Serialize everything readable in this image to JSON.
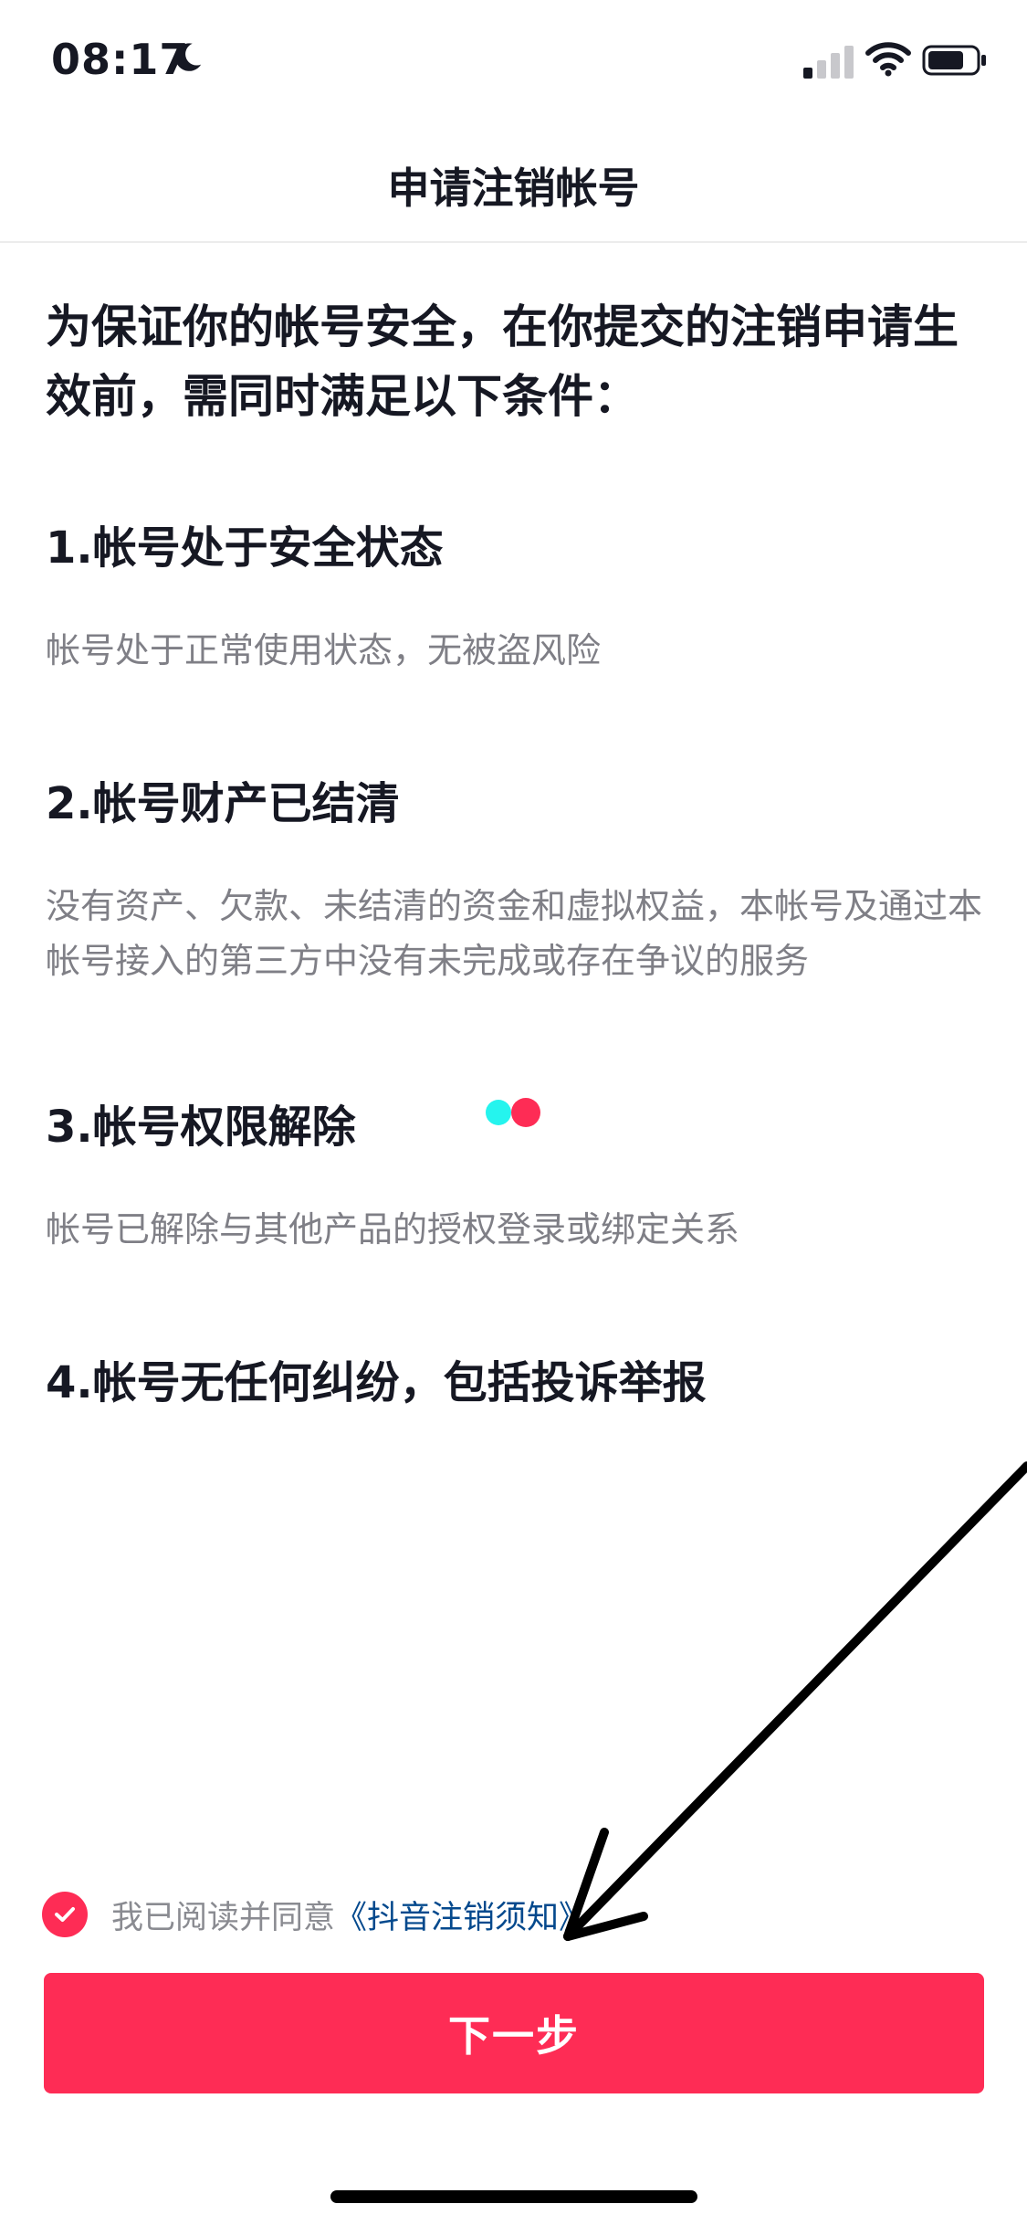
{
  "status_bar": {
    "time": "08:17",
    "icons": [
      "moon-icon",
      "cellular-signal-icon",
      "wifi-icon",
      "battery-icon"
    ]
  },
  "nav": {
    "title": "申请注销帐号"
  },
  "intro": "为保证你的帐号安全，在你提交的注销申请生效前，需同时满足以下条件：",
  "conditions": [
    {
      "title": "1.帐号处于安全状态",
      "description": "帐号处于正常使用状态，无被盗风险"
    },
    {
      "title": "2.帐号财产已结清",
      "description": "没有资产、欠款、未结清的资金和虚拟权益，本帐号及通过本帐号接入的第三方中没有未完成或存在争议的服务"
    },
    {
      "title": "3.帐号权限解除",
      "description": "帐号已解除与其他产品的授权登录或绑定关系"
    },
    {
      "title": "4.帐号无任何纠纷，包括投诉举报",
      "description": ""
    }
  ],
  "agreement": {
    "checked": true,
    "text": "我已阅读并同意",
    "link": "《抖音注销须知》"
  },
  "next_button": {
    "label": "下一步"
  },
  "colors": {
    "accent": "#fe2c55",
    "link": "#04498d",
    "loader_cyan": "#25f4ee",
    "loader_red": "#fe2c55"
  }
}
